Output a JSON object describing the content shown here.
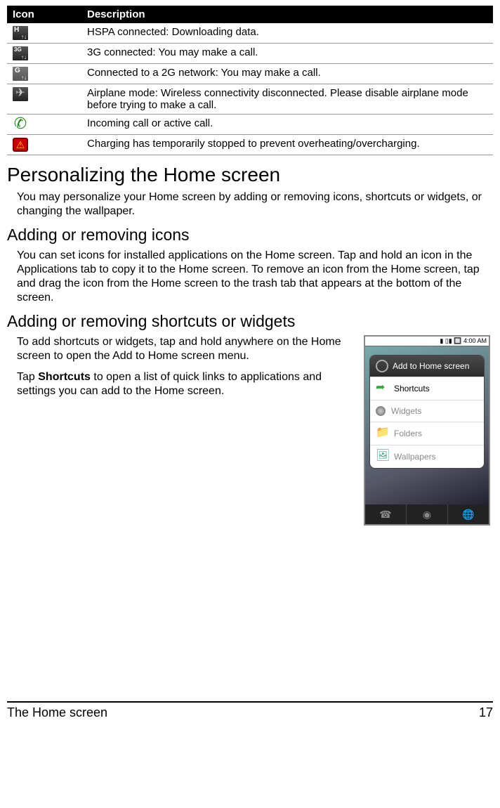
{
  "table": {
    "headers": {
      "icon": "Icon",
      "description": "Description"
    },
    "rows": [
      {
        "desc": "HSPA connected: Downloading data."
      },
      {
        "desc": "3G connected: You may make a call."
      },
      {
        "desc": "Connected to a 2G network: You may make a call."
      },
      {
        "desc": "Airplane mode: Wireless connectivity disconnected. Please disable airplane mode before trying to make a call."
      },
      {
        "desc": "Incoming call or active call."
      },
      {
        "desc": "Charging has temporarily stopped to prevent overheating/overcharging."
      }
    ]
  },
  "section1": {
    "title": "Personalizing the Home screen",
    "body": "You may personalize your Home screen by adding or removing icons, shortcuts or widgets, or changing the wallpaper."
  },
  "section2": {
    "title": "Adding or removing icons",
    "body": "You can set icons for installed applications on the Home screen. Tap and hold an icon in the Applications tab to copy it to the Home screen. To remove an icon from the Home screen, tap and drag the icon from the Home screen to the trash tab that appears at the bottom of the screen."
  },
  "section3": {
    "title": "Adding or removing shortcuts or widgets",
    "p1": "To add shortcuts or widgets, tap and hold anywhere on the Home screen to open the Add to Home screen menu.",
    "p2_pre": "Tap ",
    "p2_bold": "Shortcuts",
    "p2_post": " to open a list of quick links to applications and settings you can add to the Home screen."
  },
  "phone": {
    "status_time": "4:00 AM",
    "dialog_title": "Add to Home screen",
    "rows": {
      "shortcuts": "Shortcuts",
      "widgets": "Widgets",
      "folders": "Folders",
      "wallpapers": "Wallpapers"
    }
  },
  "footer": {
    "title": "The Home screen",
    "page": "17"
  }
}
